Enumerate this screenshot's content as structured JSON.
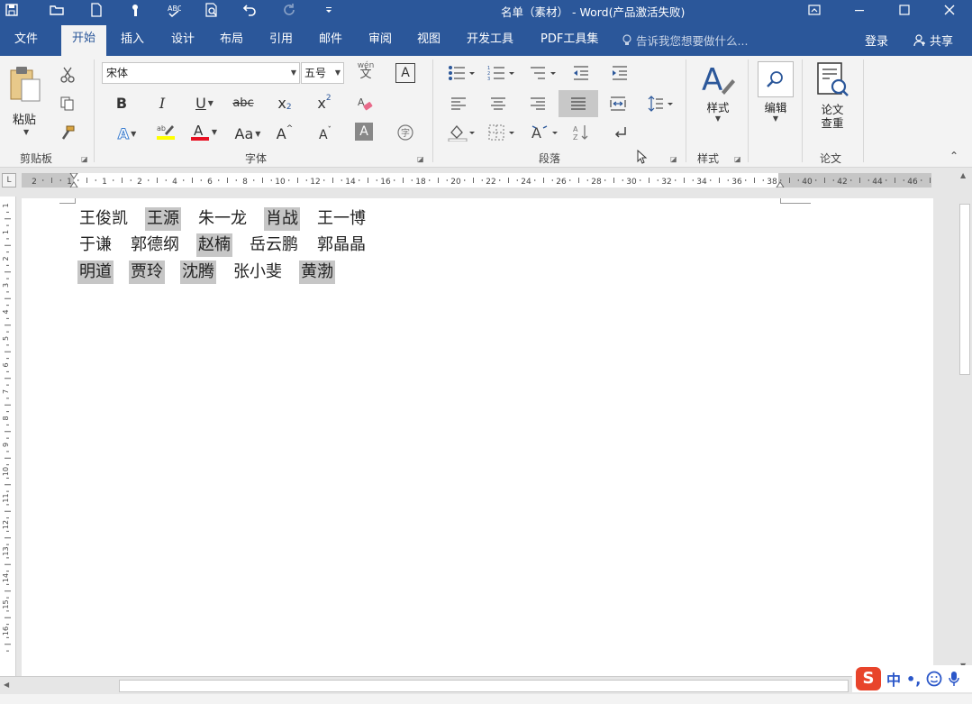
{
  "window": {
    "title": "名单（素材） - Word(产品激活失败)"
  },
  "tabs": [
    {
      "label": "文件"
    },
    {
      "label": "开始"
    },
    {
      "label": "插入"
    },
    {
      "label": "设计"
    },
    {
      "label": "布局"
    },
    {
      "label": "引用"
    },
    {
      "label": "邮件"
    },
    {
      "label": "审阅"
    },
    {
      "label": "视图"
    },
    {
      "label": "开发工具"
    },
    {
      "label": "PDF工具集"
    }
  ],
  "active_tab": "开始",
  "tell_me": "告诉我您想要做什么...",
  "signin": "登录",
  "share": "共享",
  "clipboard": {
    "paste": "粘贴",
    "group": "剪贴板"
  },
  "font": {
    "name": "宋体",
    "size": "五号",
    "phonetic": "wén",
    "phonetic_char": "文",
    "border_char": "A",
    "bold": "B",
    "italic": "I",
    "underline": "U",
    "strike": "abc",
    "sub": "x",
    "sup": "x",
    "grow": "A",
    "shrink": "A",
    "aa": "Aa",
    "group": "字体"
  },
  "paragraph": {
    "group": "段落"
  },
  "styles": {
    "label": "样式",
    "group": "样式"
  },
  "editing": {
    "label": "编辑"
  },
  "thesis": {
    "label1": "论文",
    "label2": "查重",
    "group": "论文"
  },
  "ruler_numbers": [
    "2",
    "1",
    "1",
    "2",
    "4",
    "6",
    "8",
    "10",
    "12",
    "14",
    "16",
    "18",
    "20",
    "22",
    "24",
    "26",
    "28",
    "30",
    "32",
    "34",
    "36",
    "38",
    "40",
    "42",
    "44",
    "46",
    "48"
  ],
  "vruler_numbers": [
    "1",
    "1",
    "2",
    "3",
    "4",
    "5",
    "6",
    "7",
    "8",
    "9",
    "10",
    "11",
    "12",
    "13",
    "14",
    "15",
    "16"
  ],
  "document": {
    "lines": [
      [
        {
          "text": "王俊凯",
          "hl": false
        },
        {
          "text": "王源",
          "hl": true
        },
        {
          "text": "朱一龙",
          "hl": false
        },
        {
          "text": "肖战",
          "hl": true
        },
        {
          "text": "王一博",
          "hl": false
        }
      ],
      [
        {
          "text": "于谦",
          "hl": false
        },
        {
          "text": "郭德纲",
          "hl": false
        },
        {
          "text": "赵楠",
          "hl": true
        },
        {
          "text": "岳云鹏",
          "hl": false
        },
        {
          "text": "郭晶晶",
          "hl": false
        }
      ],
      [
        {
          "text": "明道",
          "hl": true
        },
        {
          "text": "贾玲",
          "hl": true
        },
        {
          "text": "沈腾",
          "hl": true
        },
        {
          "text": "张小斐",
          "hl": false
        },
        {
          "text": "黄渤",
          "hl": true
        }
      ]
    ]
  },
  "ime": {
    "mode": "中"
  },
  "colors": {
    "brand": "#2b579a",
    "highlight": "#c6c6c6",
    "font_red": "#e81123",
    "hl_yellow": "#ffff00"
  }
}
